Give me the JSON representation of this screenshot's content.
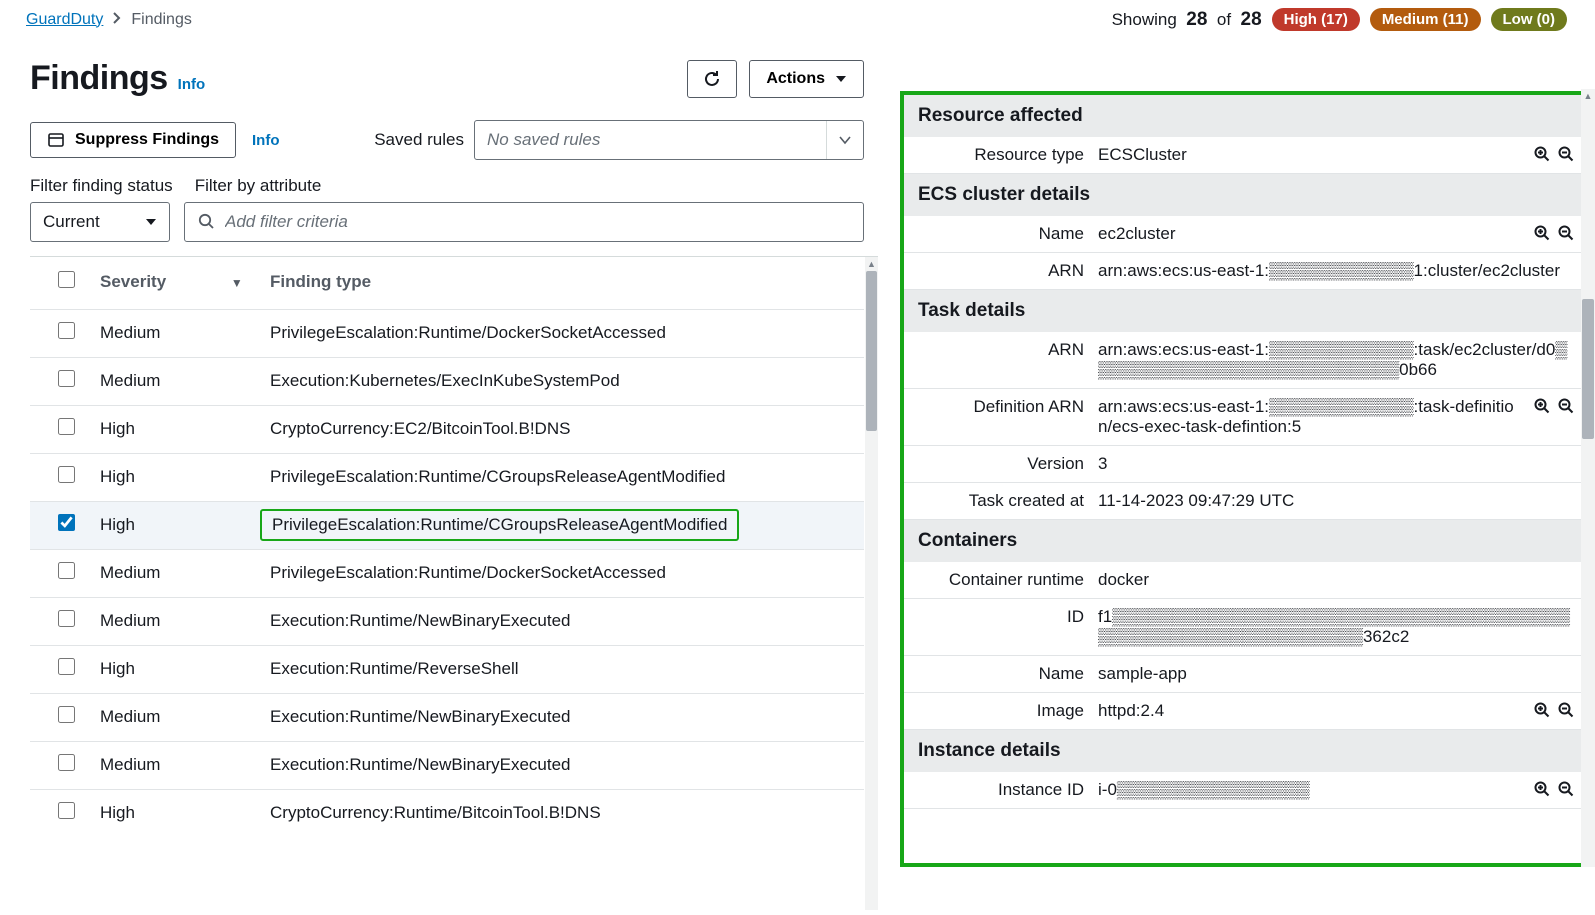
{
  "breadcrumb": {
    "root": "GuardDuty",
    "current": "Findings"
  },
  "counts": {
    "showing_label_pre": "Showing",
    "shown": "28",
    "of_label": "of",
    "total": "28"
  },
  "badges": {
    "high": "High (17)",
    "medium": "Medium (11)",
    "low": "Low (0)"
  },
  "page": {
    "title": "Findings",
    "info": "Info"
  },
  "actions": {
    "actions_label": "Actions",
    "suppress_label": "Suppress Findings",
    "info": "Info"
  },
  "saved_rules": {
    "label": "Saved rules",
    "placeholder": "No saved rules"
  },
  "filters": {
    "status_label": "Filter finding status",
    "attr_label": "Filter by attribute",
    "status_value": "Current",
    "search_placeholder": "Add filter criteria"
  },
  "table": {
    "columns": {
      "severity": "Severity",
      "type": "Finding type"
    },
    "rows": [
      {
        "sev": "Medium",
        "type": "PrivilegeEscalation:Runtime/DockerSocketAccessed",
        "checked": false
      },
      {
        "sev": "Medium",
        "type": "Execution:Kubernetes/ExecInKubeSystemPod",
        "checked": false
      },
      {
        "sev": "High",
        "type": "CryptoCurrency:EC2/BitcoinTool.B!DNS",
        "checked": false
      },
      {
        "sev": "High",
        "type": "PrivilegeEscalation:Runtime/CGroupsReleaseAgentModified",
        "checked": false
      },
      {
        "sev": "High",
        "type": "PrivilegeEscalation:Runtime/CGroupsReleaseAgentModified",
        "checked": true,
        "highlighted": true
      },
      {
        "sev": "Medium",
        "type": "PrivilegeEscalation:Runtime/DockerSocketAccessed",
        "checked": false
      },
      {
        "sev": "Medium",
        "type": "Execution:Runtime/NewBinaryExecuted",
        "checked": false
      },
      {
        "sev": "High",
        "type": "Execution:Runtime/ReverseShell",
        "checked": false
      },
      {
        "sev": "Medium",
        "type": "Execution:Runtime/NewBinaryExecuted",
        "checked": false
      },
      {
        "sev": "Medium",
        "type": "Execution:Runtime/NewBinaryExecuted",
        "checked": false
      },
      {
        "sev": "High",
        "type": "CryptoCurrency:Runtime/BitcoinTool.B!DNS",
        "checked": false
      }
    ]
  },
  "details": {
    "sections": [
      {
        "title": "Resource affected",
        "rows": [
          {
            "k": "Resource type",
            "v": "ECSCluster",
            "zoom": true
          }
        ]
      },
      {
        "title": "ECS cluster details",
        "rows": [
          {
            "k": "Name",
            "v": "ec2cluster",
            "zoom": true
          },
          {
            "k": "ARN",
            "v": "arn:aws:ecs:us-east-1:▒▒▒▒▒▒▒▒▒▒▒▒1:cluster/ec2cluster"
          }
        ]
      },
      {
        "title": "Task details",
        "rows": [
          {
            "k": "ARN",
            "v": "arn:aws:ecs:us-east-1:▒▒▒▒▒▒▒▒▒▒▒▒:task/ec2cluster/d0▒▒▒▒▒▒▒▒▒▒▒▒▒▒▒▒▒▒▒▒▒▒▒▒▒▒0b66"
          },
          {
            "k": "Definition ARN",
            "v": "arn:aws:ecs:us-east-1:▒▒▒▒▒▒▒▒▒▒▒▒:task-definition/ecs-exec-task-defintion:5",
            "zoom": true
          },
          {
            "k": "Version",
            "v": "3"
          },
          {
            "k": "Task created at",
            "v": "11-14-2023 09:47:29 UTC"
          }
        ]
      },
      {
        "title": "Containers",
        "rows": [
          {
            "k": "Container runtime",
            "v": "docker"
          },
          {
            "k": "ID",
            "v": "f1▒▒▒▒▒▒▒▒▒▒▒▒▒▒▒▒▒▒▒▒▒▒▒▒▒▒▒▒▒▒▒▒▒▒▒▒▒▒▒▒▒▒▒▒▒▒▒▒▒▒▒▒▒▒▒▒▒▒▒▒362c2"
          },
          {
            "k": "Name",
            "v": "sample-app"
          },
          {
            "k": "Image",
            "v": "httpd:2.4",
            "zoom": true
          }
        ]
      },
      {
        "title": "Instance details",
        "rows": [
          {
            "k": "Instance ID",
            "v": "i-0▒▒▒▒▒▒▒▒▒▒▒▒▒▒▒▒",
            "zoom": true
          }
        ]
      }
    ]
  }
}
